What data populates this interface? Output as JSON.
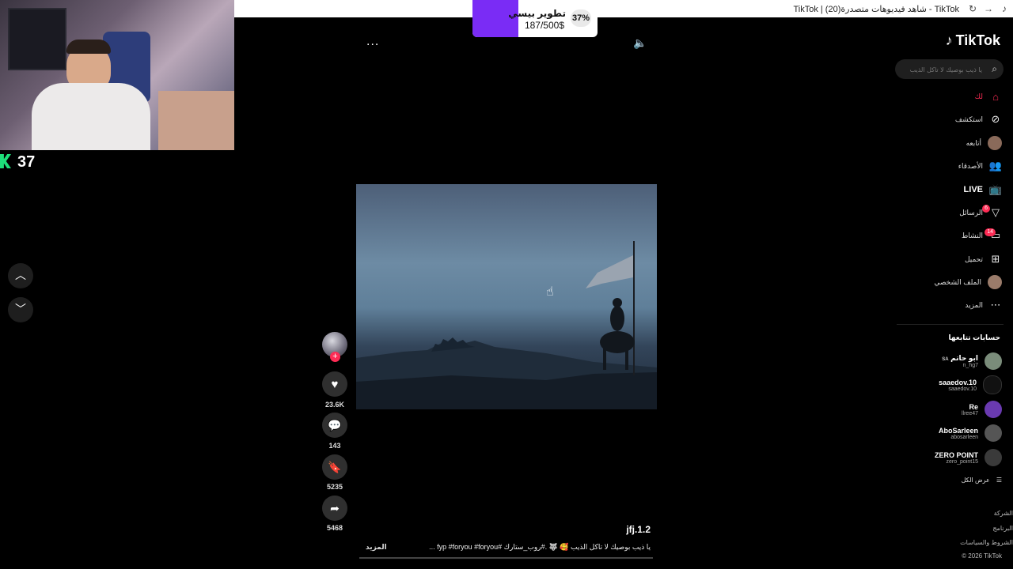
{
  "browser": {
    "window_title": "TikTok | شاهد فيديوهات متصدرة(20) - TikTok",
    "icons": [
      "refresh-icon",
      "forward-icon",
      "tiktok-favicon"
    ]
  },
  "stream_overlay": {
    "counter_value": "37",
    "donation": {
      "title": "تطوير بيسي",
      "amount": "187/500$",
      "percent": "37%",
      "progress_fraction": 0.37,
      "accent_color": "#7a2cf5"
    }
  },
  "video": {
    "more_label": "...",
    "author": "jfj.1.2",
    "caption": "يا ذيب بوصيك لا تاكل الذيب 🥰 🐺 .#روب_ستارك #fyp #foryou #foryou ...",
    "more_link": "المزيد",
    "playback_progress": 0.0
  },
  "actions": {
    "likes": "23.6K",
    "comments": "143",
    "saves": "5235",
    "shares": "5468"
  },
  "sidebar": {
    "logo": "TikTok",
    "search_placeholder": "يا ذيب بوصيك لا تاكل الذيب",
    "nav": [
      {
        "label": "لك",
        "icon": "home-icon",
        "active": true
      },
      {
        "label": "استكشف",
        "icon": "compass-icon"
      },
      {
        "label": "أتابعه",
        "icon": "following-avatar-icon"
      },
      {
        "label": "الأصدقاء",
        "icon": "friends-icon"
      },
      {
        "label": "LIVE",
        "icon": "live-icon"
      },
      {
        "label": "الرسائل",
        "icon": "messages-icon",
        "badge": "6"
      },
      {
        "label": "النشاط",
        "icon": "activity-icon",
        "badge": "14"
      },
      {
        "label": "تحميل",
        "icon": "upload-icon"
      },
      {
        "label": "الملف الشخصي",
        "icon": "profile-avatar-icon"
      },
      {
        "label": "المزيد",
        "icon": "more-icon"
      }
    ],
    "following_title": "حسابات تتابعها",
    "following": [
      {
        "name": "ابو حاتم",
        "tag": "SA",
        "handle": "n_hg7"
      },
      {
        "name": "saaedov.10",
        "handle": "saaedov.10"
      },
      {
        "name": "Re",
        "handle": "llree47"
      },
      {
        "name": "AboSarleen",
        "handle": "abosarleen"
      },
      {
        "name": "ZERO POINT",
        "handle": "zero_point15"
      }
    ],
    "see_all": "عرض الكل",
    "footer": [
      "الشركة",
      "البرنامج",
      "الشروط والسياسات",
      "© 2026 TikTok"
    ],
    "accent_color": "#fe2c55"
  }
}
